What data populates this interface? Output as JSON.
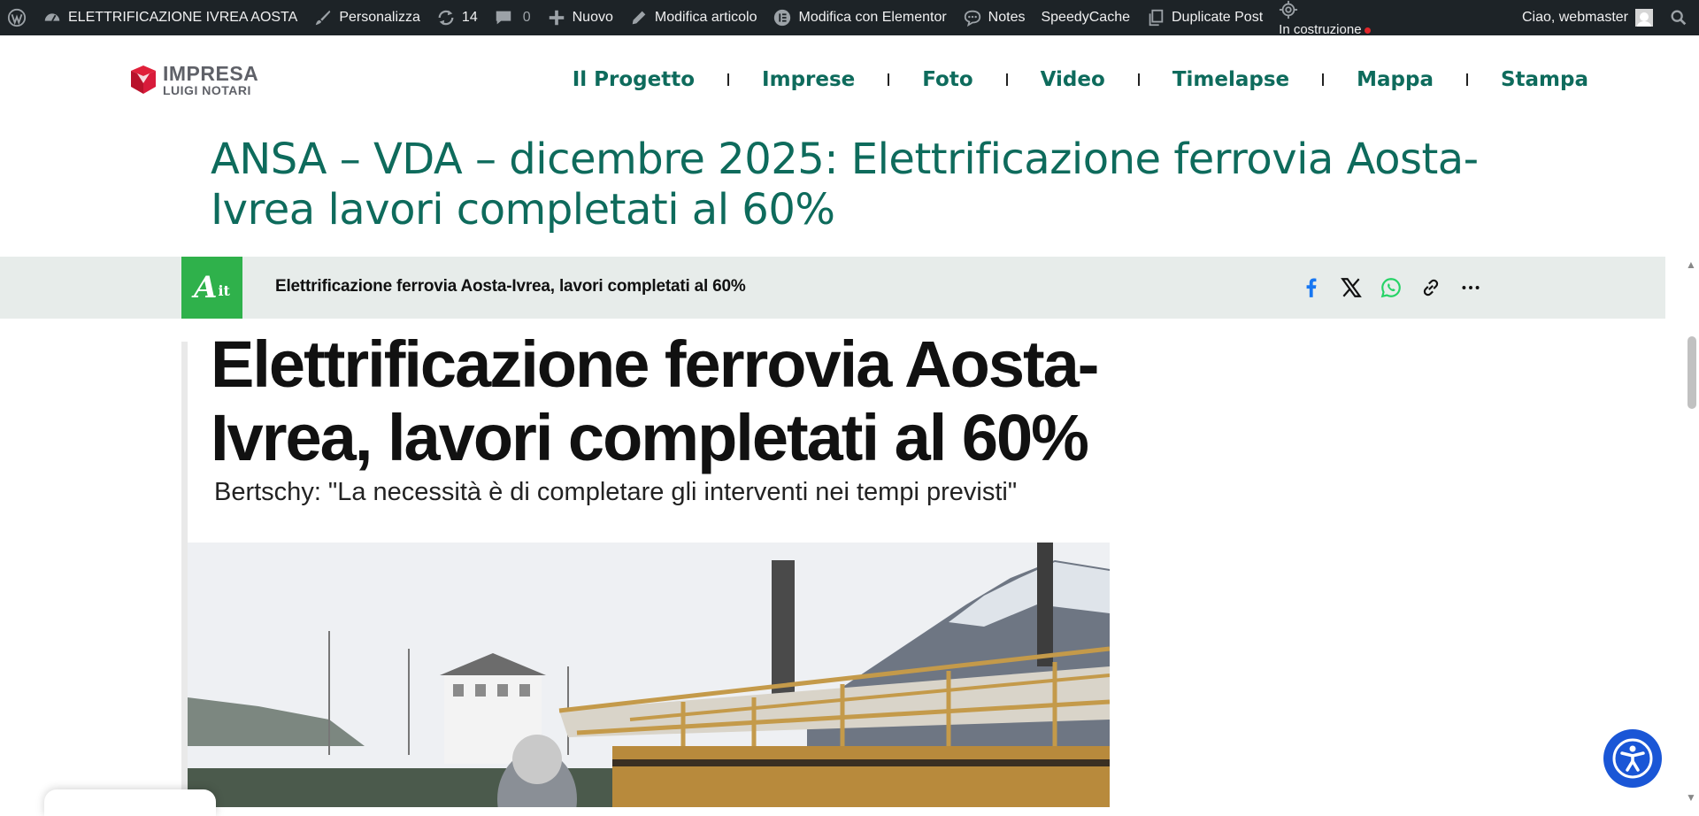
{
  "adminbar": {
    "site_name": "ELETTRIFICAZIONE IVREA AOSTA",
    "customize": "Personalizza",
    "updates_count": "14",
    "comments_count": "0",
    "new_label": "Nuovo",
    "edit_post": "Modifica articolo",
    "edit_elementor": "Modifica con Elementor",
    "notes": "Notes",
    "speedycache": "SpeedyCache",
    "duplicate_post": "Duplicate Post",
    "status_label": "In costruzione",
    "greeting": "Ciao, webmaster"
  },
  "logo": {
    "line1": "IMPRESA",
    "line2": "LUIGI NOTARI"
  },
  "nav": {
    "items": [
      "Il Progetto",
      "Imprese",
      "Foto",
      "Video",
      "Timelapse",
      "Mappa",
      "Stampa"
    ]
  },
  "post": {
    "title": "ANSA – VDA – dicembre 2025: Elettrificazione ferrovia Aosta-Ivrea lavori completati al 60%"
  },
  "ansa": {
    "logo_main": "A",
    "logo_suffix": "it",
    "bar_title": "Elettrificazione ferrovia Aosta-Ivrea, lavori completati al 60%",
    "headline": "Elettrificazione ferrovia Aosta-Ivrea, lavori completati al 60%",
    "subtitle": "Bertschy: \"La necessità è di completare gli interventi nei tempi previsti\""
  },
  "share": {
    "icons": [
      "facebook-icon",
      "x-icon",
      "whatsapp-icon",
      "link-icon",
      "more-icon"
    ]
  },
  "colors": {
    "admin_bar_bg": "#1d2327",
    "brand_green": "#0e6b5c",
    "ansa_green": "#2fb14b",
    "ansa_bar_bg": "#e7ecea",
    "accessibility_blue": "#1a56d6",
    "facebook_blue": "#1877f2",
    "whatsapp_green": "#25d366"
  }
}
